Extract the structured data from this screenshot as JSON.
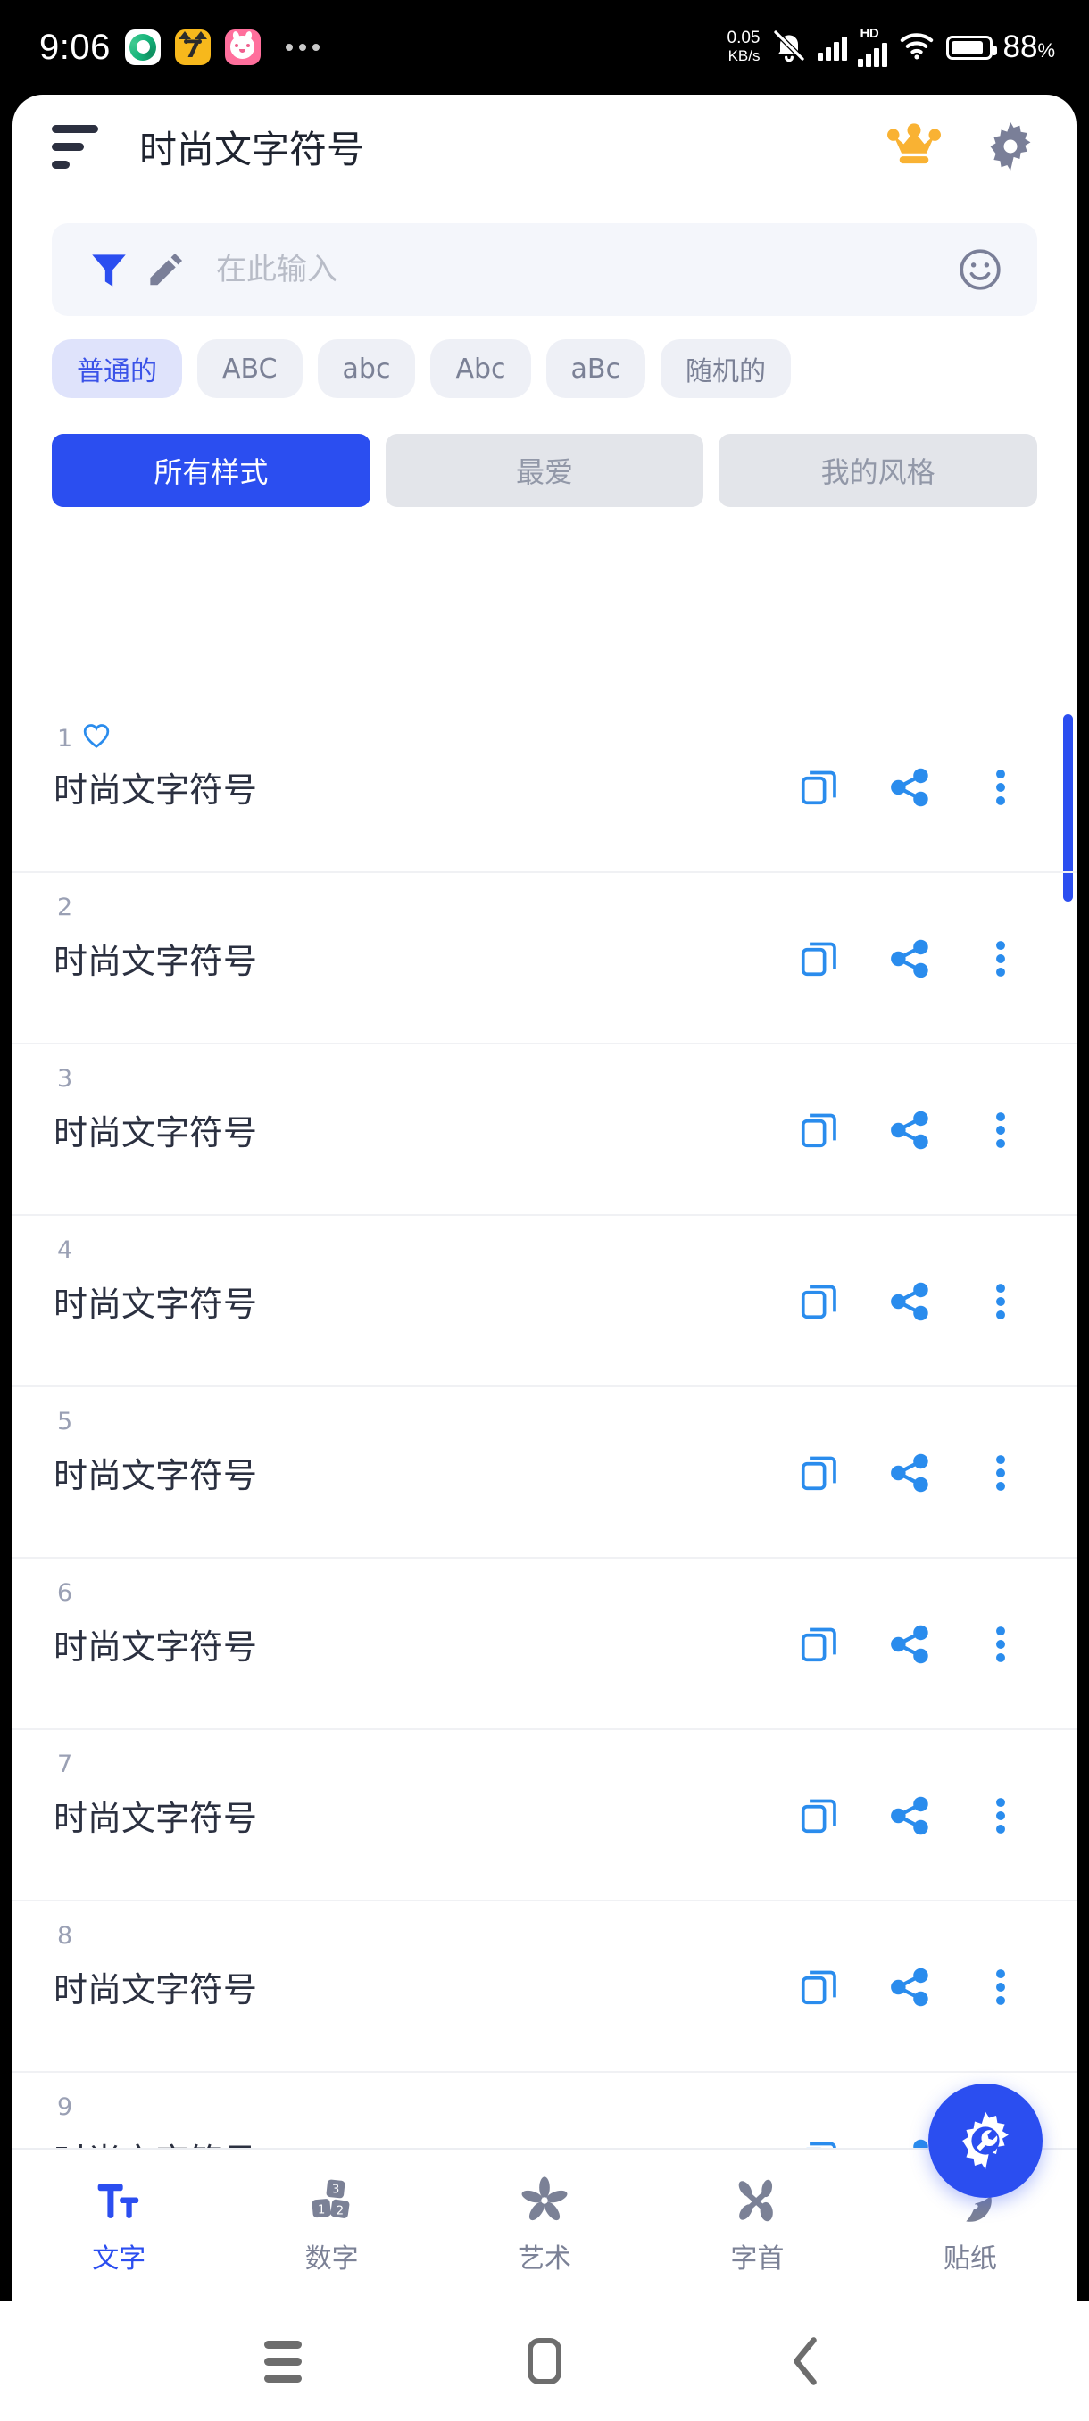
{
  "status_bar": {
    "time": "9:06",
    "net_speed_value": "0.05",
    "net_speed_unit": "KB/s",
    "battery_percent": "88",
    "battery_percent_symbol": "%",
    "hd_label": "HD",
    "notification_icons": [
      "green-swirl-app-icon",
      "yellow-cat-seven-app-icon",
      "pink-bunny-app-icon",
      "more-notifications-icon"
    ],
    "right_icons": [
      "mute-bell-icon",
      "signal-bars-icon",
      "hd-signal-bars-icon",
      "wifi-icon",
      "battery-icon"
    ]
  },
  "header": {
    "menu_icon": "sort-lines-icon",
    "title": "时尚文字符号",
    "crown_icon": "crown-icon",
    "settings_icon": "gear-icon"
  },
  "search": {
    "filter_icon": "funnel-filter-icon",
    "edit_icon": "pencil-icon",
    "placeholder": "在此输入",
    "value": "",
    "emoji_icon": "smiley-face-icon"
  },
  "chips": [
    {
      "label": "普通的",
      "active": true
    },
    {
      "label": "ABC",
      "active": false
    },
    {
      "label": "abc",
      "active": false
    },
    {
      "label": "Abc",
      "active": false
    },
    {
      "label": "aBc",
      "active": false
    },
    {
      "label": "随机的",
      "active": false
    }
  ],
  "tabs": [
    {
      "label": "所有样式",
      "active": true
    },
    {
      "label": "最爱",
      "active": false
    },
    {
      "label": "我的风格",
      "active": false
    }
  ],
  "list": {
    "row_actions": [
      "copy-icon",
      "share-icon",
      "more-vertical-icon"
    ],
    "rows": [
      {
        "number": "1",
        "text": "时尚文字符号",
        "favorite": true
      },
      {
        "number": "2",
        "text": "时尚文字符号",
        "favorite": false
      },
      {
        "number": "3",
        "text": "时尚文字符号",
        "favorite": false
      },
      {
        "number": "4",
        "text": "时尚文字符号",
        "favorite": false
      },
      {
        "number": "5",
        "text": "时尚文字符号",
        "favorite": false
      },
      {
        "number": "6",
        "text": "时尚文字符号",
        "favorite": false
      },
      {
        "number": "7",
        "text": "时尚文字符号",
        "favorite": false
      },
      {
        "number": "8",
        "text": "时尚文字符号",
        "favorite": false
      },
      {
        "number": "9",
        "text": "时尚文字符号",
        "favorite": false
      }
    ]
  },
  "fab": {
    "icon": "gear-wrench-icon"
  },
  "bottom_nav": [
    {
      "label": "文字",
      "icon": "text-tool-icon",
      "active": true
    },
    {
      "label": "数字",
      "icon": "number-blocks-icon",
      "active": false
    },
    {
      "label": "艺术",
      "icon": "flower-art-icon",
      "active": false
    },
    {
      "label": "字首",
      "icon": "monogram-icon",
      "active": false
    },
    {
      "label": "贴纸",
      "icon": "sticker-smiley-icon",
      "active": false
    }
  ],
  "android_nav": {
    "recents": "recents-icon",
    "home": "home-icon",
    "back": "back-icon"
  },
  "colors": {
    "accent_blue": "#2b4ef0",
    "icon_blue": "#2a8ced",
    "chip_active_bg": "#dfe3fb",
    "chip_active_text": "#3a52e8",
    "muted_text": "#7b8196",
    "crown_yellow": "#f9b233"
  }
}
